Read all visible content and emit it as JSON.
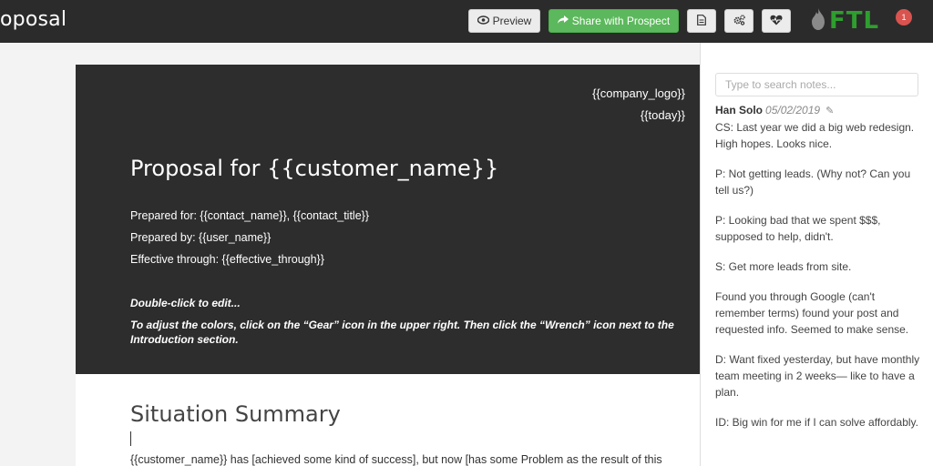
{
  "header": {
    "title": "oposal",
    "preview_label": "Preview",
    "share_label": "Share with Prospect",
    "logo_text": "FTL",
    "notification_count": "1"
  },
  "document": {
    "company_logo": "{{company_logo}}",
    "today": "{{today}}",
    "title": "Proposal for {{customer_name}}",
    "prepared_for": "Prepared for: {{contact_name}}, {{contact_title}}",
    "prepared_by": "Prepared by: {{user_name}}",
    "effective": "Effective through: {{effective_through}}",
    "edit_hint": "Double-click to edit...",
    "color_hint": "To adjust the colors, click on the “Gear” icon in the upper right. Then click the “Wrench” icon next to the Introduction section.",
    "section_title": "Situation Summary",
    "body_text": "{{customer_name}} has [achieved some kind of success], but now [has some Problem as the result of this"
  },
  "notes": {
    "search_placeholder": "Type to search notes...",
    "author": "Han Solo",
    "date": "05/02/2019",
    "items": [
      "CS: Last year we did a big web redesign. High hopes. Looks nice.",
      "P: Not getting leads. (Why not? Can you tell us?)",
      "P: Looking bad that we spent $$$, supposed to help, didn't.",
      "S: Get more leads from site.",
      "Found you through Google (can't remember terms) found your post and requested info. Seemed to make sense.",
      "D: Want fixed yesterday, but have monthly team meeting in 2 weeks— like to have a plan.",
      "ID: Big win for me if I can solve affordably."
    ]
  },
  "colors": {
    "topbar": "#2b2b2b",
    "share_button": "#5cb85c",
    "hero_background": "#2d2d2d",
    "logo_green": "#2e9e2e",
    "badge_red": "#d9534f"
  }
}
